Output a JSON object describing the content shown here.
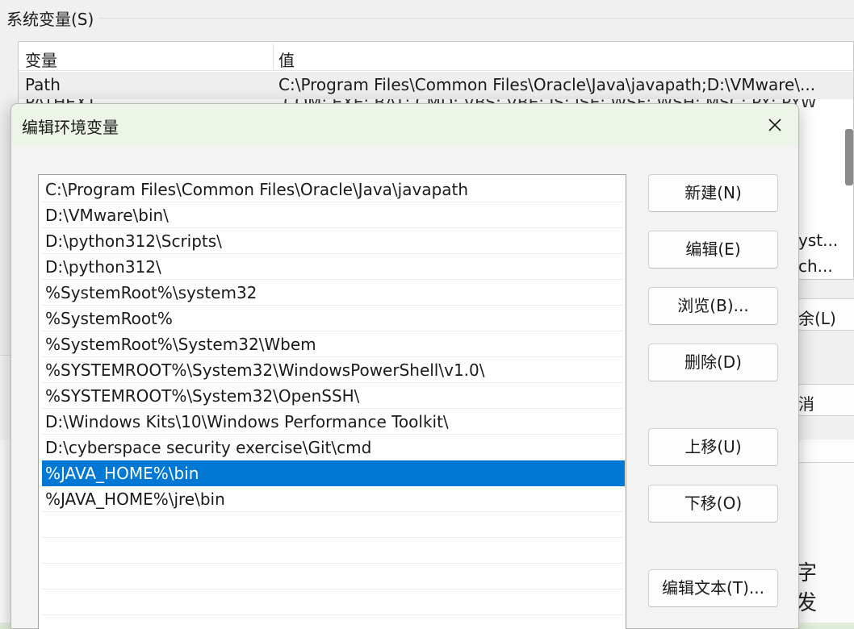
{
  "background_window": {
    "group_title": "系统变量(S)",
    "columns": {
      "variable": "变量",
      "value": "值"
    },
    "rows": [
      {
        "variable": "Path",
        "value": "C:\\Program Files\\Common Files\\Oracle\\Java\\javapath;D:\\VMware\\..."
      },
      {
        "variable": "PATHEXT",
        "value": ".COM;.EXE;.BAT;.CMD;.VBS;.VBE;.JS;.JSE;.WSF;.WSH;.MSC;.PY;.PYW"
      }
    ],
    "peek_values": [
      "yst...",
      "ch..."
    ],
    "peek_buttons": {
      "delete": "余(L)",
      "cancel": "消"
    },
    "peek_text": "字 发"
  },
  "dialog": {
    "title": "编辑环境变量",
    "close_glyph": "✕",
    "entries": [
      "C:\\Program Files\\Common Files\\Oracle\\Java\\javapath",
      "D:\\VMware\\bin\\",
      "D:\\python312\\Scripts\\",
      "D:\\python312\\",
      "%SystemRoot%\\system32",
      "%SystemRoot%",
      "%SystemRoot%\\System32\\Wbem",
      "%SYSTEMROOT%\\System32\\WindowsPowerShell\\v1.0\\",
      "%SYSTEMROOT%\\System32\\OpenSSH\\",
      "D:\\Windows Kits\\10\\Windows Performance Toolkit\\",
      "D:\\cyberspace security exercise\\Git\\cmd",
      "%JAVA_HOME%\\bin",
      "%JAVA_HOME%\\jre\\bin"
    ],
    "selected_index": 11,
    "buttons": {
      "new": "新建(N)",
      "edit": "编辑(E)",
      "browse": "浏览(B)...",
      "delete": "删除(D)",
      "move_up": "上移(U)",
      "move_down": "下移(O)",
      "edit_text": "编辑文本(T)..."
    },
    "colors": {
      "selection": "#0078d4",
      "titlebar": "#ecf5e8"
    }
  }
}
